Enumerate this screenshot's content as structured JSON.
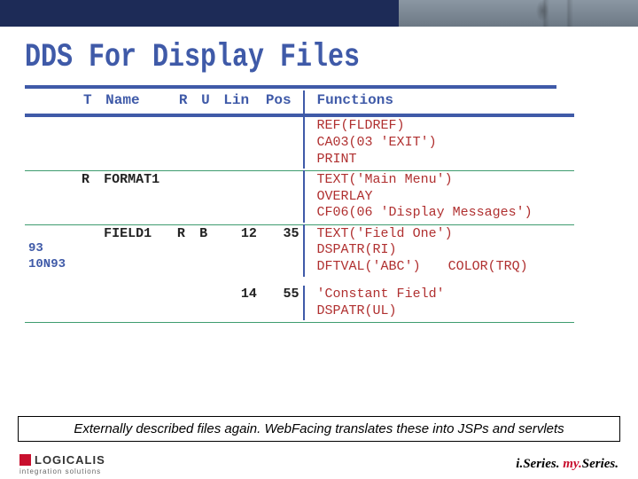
{
  "title": "DDS For Display Files",
  "headers": {
    "t": "T",
    "name": "Name",
    "r": "R",
    "u": "U",
    "lin": "Lin",
    "pos": "Pos",
    "functions": "Functions"
  },
  "rows": {
    "r0": {
      "f1": "REF(FLDREF)",
      "f2": "CA03(03 'EXIT')",
      "f3": "PRINT"
    },
    "r1": {
      "t": "R",
      "name": "FORMAT1",
      "f1": "TEXT('Main Menu')",
      "f2": "OVERLAY",
      "f3": "CF06(06 'Display Messages')"
    },
    "r2": {
      "ind1": "93",
      "ind2": "10N93",
      "name": "FIELD1",
      "r": "R",
      "u": "B",
      "lin": "12",
      "pos": "35",
      "f1": "TEXT('Field One')",
      "f2": "DSPATR(RI)",
      "f3": "DFTVAL('ABC')",
      "f3b": "COLOR(TRQ)"
    },
    "r3": {
      "lin": "14",
      "pos": "55",
      "f1": "'Constant Field'",
      "f2": "DSPATR(UL)"
    }
  },
  "caption": "Externally described files again. WebFacing translates these into JSPs and servlets",
  "footer": {
    "logicalis": "LOGICALIS",
    "tag": "integration solutions",
    "s1": "i.Series.",
    "s2": "my.",
    "s3": "Series."
  }
}
